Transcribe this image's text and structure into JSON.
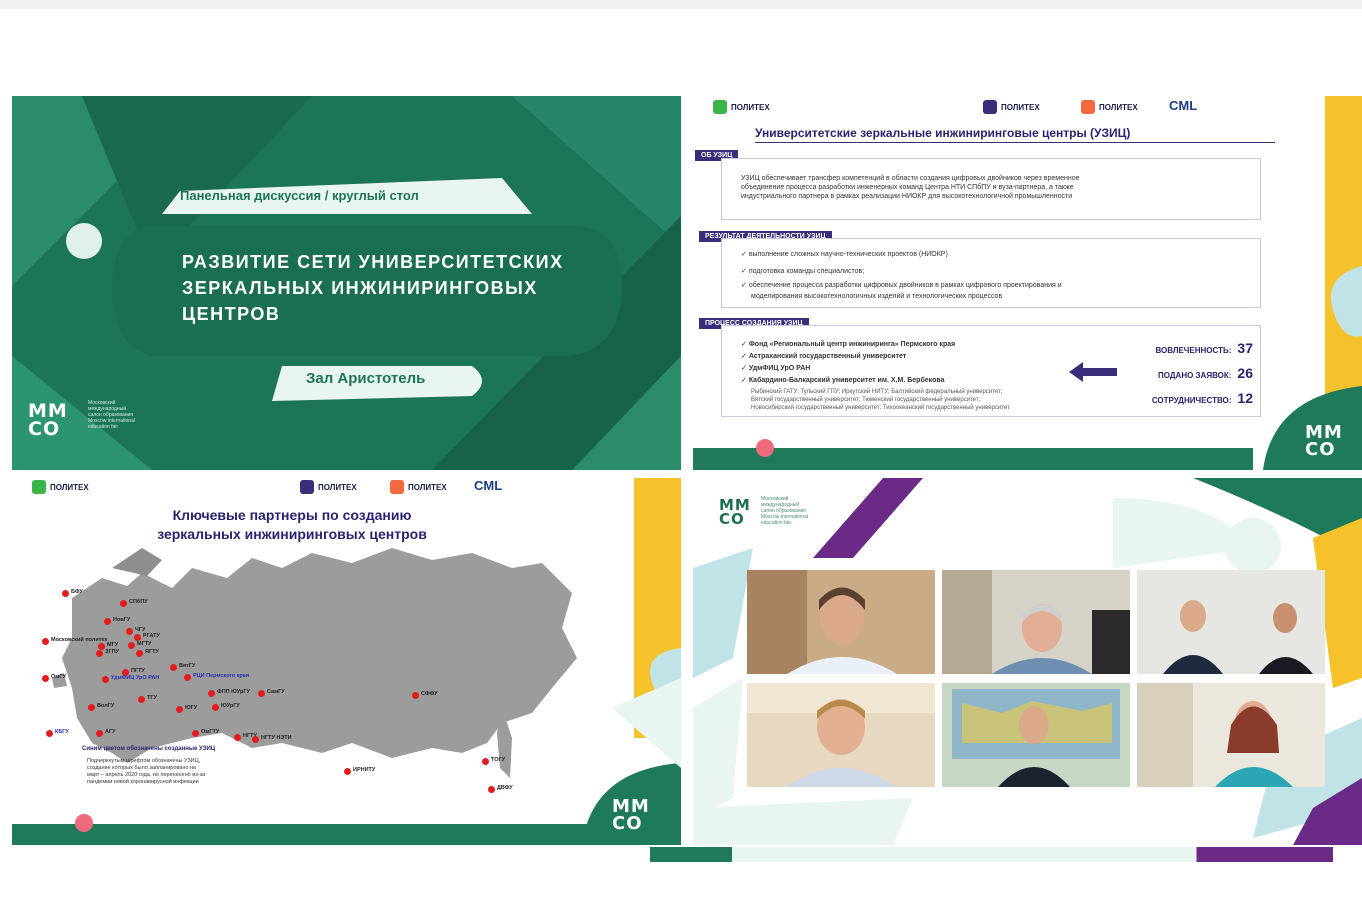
{
  "panel1": {
    "subtitle": "Панельная дискуссия / круглый стол",
    "title_lines": [
      "РАЗВИТИЕ СЕТИ УНИВЕРСИТЕТСКИХ",
      "ЗЕРКАЛЬНЫХ ИНЖИНИРИНГОВЫХ",
      "ЦЕНТРОВ"
    ],
    "hall": "Зал Аристотель",
    "logo": [
      "ММ",
      "СО"
    ],
    "logo_caption": [
      "Московский",
      "международный",
      "салон образования",
      "Moscow international",
      "education fair"
    ]
  },
  "panel2": {
    "logos": [
      "ПОЛИТЕХ",
      "ПОЛИТЕХ",
      "ПОЛИТЕХ",
      "CML"
    ],
    "title": "Университетские зеркальные инжиниринговые центры (УЗИЦ)",
    "about_tag": "ОБ УЗИЦ",
    "about_text": [
      "УЗИЦ обеспечивает трансфер компетенций в области создания цифровых двойников через временное",
      "объединение процесса разработки инженерных команд Центра НТИ СПбПУ и вуза-партнера, а также",
      "индустриального партнера в рамках реализации НИОКР для высокотехнологичной промышленности"
    ],
    "result_tag": "РЕЗУЛЬТАТ ДЕЯТЕЛЬНОСТИ УЗИЦ",
    "result_items": [
      "выполнение сложных научно-технических проектов (НИОКР)",
      "подготовка команды специалистов;",
      "обеспечение процесса разработки цифровых двойников в рамках цифрового проектирования и",
      "моделирования высокотехнологичных изделий и технологических процессов"
    ],
    "process_tag": "ПРОЦЕСС СОЗДАНИЯ УЗИЦ",
    "process_items": [
      "Фонд «Региональный центр инжиниринга» Пермского края",
      "Астраханский государственный университет",
      "УдмФИЦ УрО РАН",
      "Кабардино-Балкарский университет им. Х.М. Бербекова"
    ],
    "process_small": [
      "Рыбинский ГАТУ; Тульский ГПУ; Иркутский НИТУ; Балтийский федеральный университет;",
      "Вятский государственный университет; Тюменский государственный университет;",
      "Новосибирский государственный университет; Тихоокеанский государственный университет"
    ],
    "stats": [
      {
        "label": "ВОВЛЕЧЕННОСТЬ:",
        "value": "37"
      },
      {
        "label": "ПОДАНО ЗАЯВОК:",
        "value": "26"
      },
      {
        "label": "СОТРУДНИЧЕСТВО:",
        "value": "12"
      }
    ],
    "logo": [
      "ММ",
      "СО"
    ]
  },
  "panel3": {
    "logos": [
      "ПОЛИТЕХ",
      "ПОЛИТЕХ",
      "ПОЛИТЕХ",
      "CML"
    ],
    "title_lines": [
      "Ключевые партнеры по созданию",
      "зеркальных инжиниринговых центров"
    ],
    "city_labels": [
      "БФУ",
      "СПбПУ",
      "НовГУ",
      "ЧГУ",
      "РГАТУ",
      "Московский политех",
      "МГУ",
      "ЗГПУ",
      "МГТУ",
      "ЯГТУ",
      "ПГТУ",
      "ВятГУ",
      "ОмГУ",
      "УдмФИЦ УрО РАН",
      "РЦИ Пермского края",
      "ТГУ",
      "ФПП ЮУрГУ",
      "СамГУ",
      "ЮУрГУ",
      "ВолГУ",
      "ЮГУ",
      "КБГУ",
      "АГУ",
      "ОмГТУ",
      "НГТУ",
      "НГТУ НЭТИ",
      "СФФУ",
      "ИРНИТУ",
      "ТОГУ",
      "ДВФУ"
    ],
    "footnote_title": "Синим цветом обозначены созданные УЗИЦ",
    "footnote_text": [
      "Подчеркнутым шрифтом обозначены УЗИЦ,",
      "создание которых было запланировано на",
      "март – апрель 2020 года, но перенесено из-за",
      "пандемии новой коронавирусной инфекции"
    ],
    "logo": [
      "ММ",
      "СО"
    ]
  },
  "panel4": {
    "logo": [
      "ММ",
      "СО"
    ],
    "logo_caption": [
      "Московский",
      "международный",
      "салон образования",
      "Moscow international",
      "education fair"
    ],
    "participants": [
      "participant-1",
      "participant-2",
      "participant-3",
      "participant-4",
      "participant-5",
      "participant-6"
    ]
  },
  "colors": {
    "green": "#1f7a5c",
    "dark_green": "#17634a",
    "light_green": "#2d9470",
    "purple": "#3a2e7a",
    "yellow": "#f6c22c",
    "pink": "#e8516a",
    "teal": "#bfe3e7",
    "map_gray": "#9c9c9c",
    "dot_red": "#e21d1d"
  }
}
